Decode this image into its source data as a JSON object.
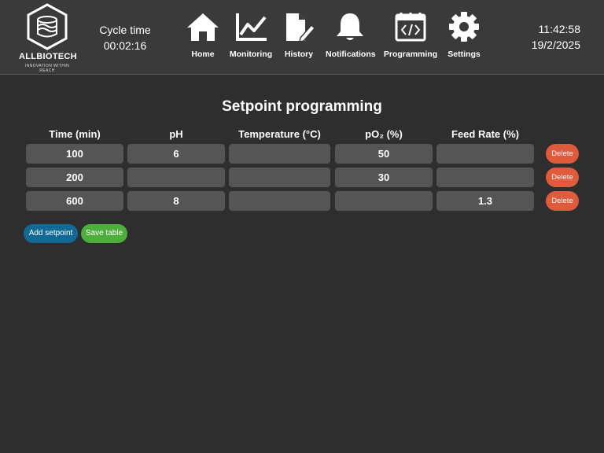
{
  "header": {
    "brand_name": "ALLBIOTECH",
    "tagline": "INNOVATION WITHIN REACH",
    "cycle_label": "Cycle time",
    "cycle_value": "00:02:16",
    "time": "11:42:58",
    "date": "19/2/2025"
  },
  "nav": [
    {
      "label": "Home",
      "icon": "home-icon"
    },
    {
      "label": "Monitoring",
      "icon": "line-chart-icon"
    },
    {
      "label": "History",
      "icon": "document-edit-icon"
    },
    {
      "label": "Notifications",
      "icon": "bell-icon"
    },
    {
      "label": "Programming",
      "icon": "code-calendar-icon"
    },
    {
      "label": "Settings",
      "icon": "gear-icon"
    }
  ],
  "main": {
    "title": "Setpoint programming",
    "columns": [
      "Time (min)",
      "pH",
      "Temperature (°C)",
      "pO₂ (%)",
      "Feed Rate (%)"
    ],
    "rows": [
      [
        "100",
        "6",
        "",
        "50",
        ""
      ],
      [
        "200",
        "",
        "",
        "30",
        ""
      ],
      [
        "600",
        "8",
        "",
        "",
        "1.3"
      ]
    ],
    "delete_label": "Delete",
    "add_label": "Add setpoint",
    "save_label": "Save table"
  },
  "colors": {
    "background": "#2e2e2e",
    "header": "#3a3a3a",
    "cell": "#555555",
    "delete": "#e05a3c",
    "add": "#116a96",
    "save": "#4cae3b"
  }
}
